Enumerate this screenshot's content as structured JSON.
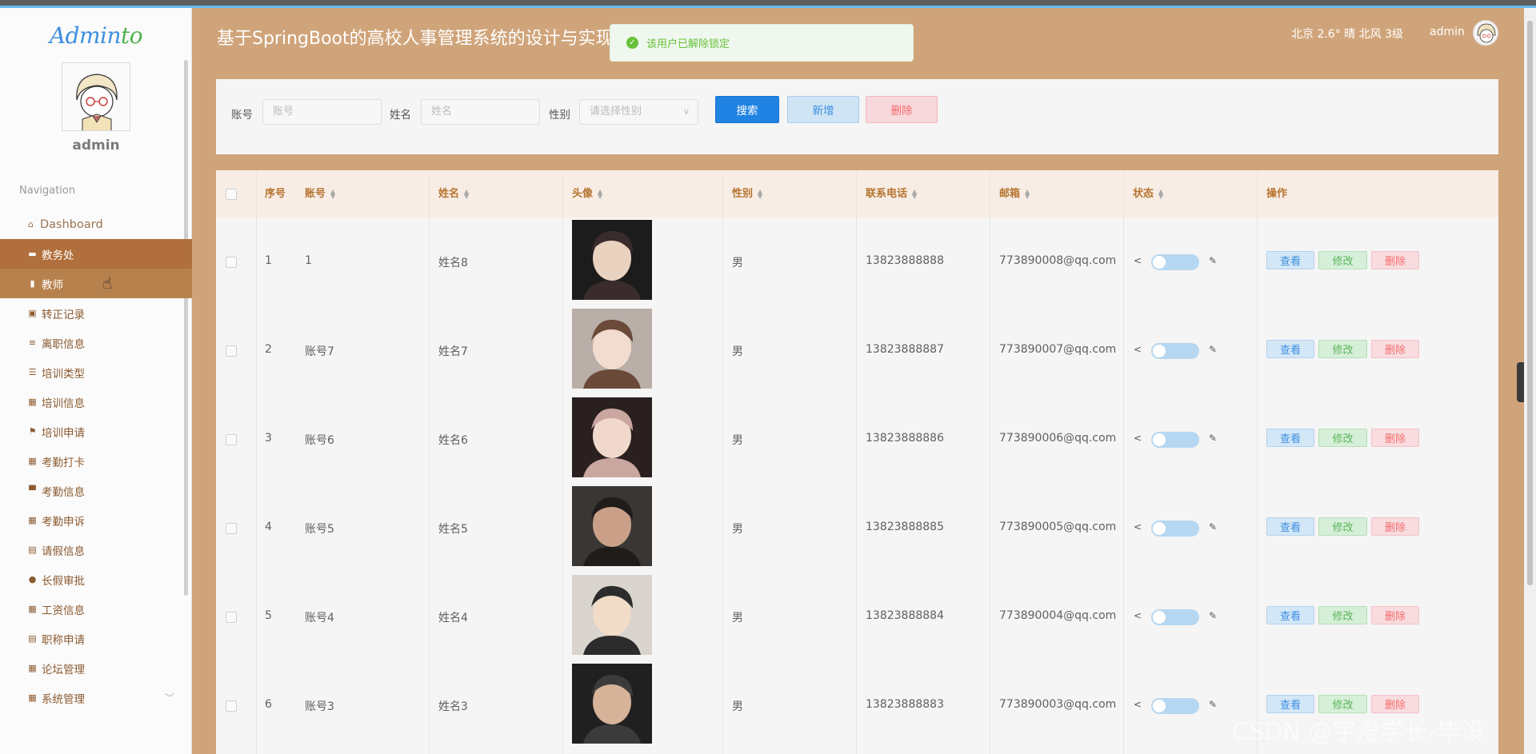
{
  "app": {
    "logo_a": "Admin",
    "logo_b": "to",
    "user": "admin",
    "nav_title": "Navigation",
    "page_title": "基于SpringBoot的高校人事管理系统的设计与实现"
  },
  "toast": {
    "message": "该用户已解除锁定"
  },
  "header": {
    "weather": "北京  2.6°  晴  北风  3级",
    "admin": "admin"
  },
  "nav": [
    {
      "label": "Dashboard",
      "icon": "home-icon"
    },
    {
      "label": "教务处",
      "icon": "card-icon"
    },
    {
      "label": "教师",
      "icon": "bar-chart-icon"
    },
    {
      "label": "转正记录",
      "icon": "chart-icon"
    },
    {
      "label": "离职信息",
      "icon": "lines-icon"
    },
    {
      "label": "培训类型",
      "icon": "list-icon"
    },
    {
      "label": "培训信息",
      "icon": "grid-icon"
    },
    {
      "label": "培训申请",
      "icon": "flag-icon"
    },
    {
      "label": "考勤打卡",
      "icon": "grid-icon"
    },
    {
      "label": "考勤信息",
      "icon": "monitor-icon"
    },
    {
      "label": "考勤申诉",
      "icon": "grid-icon"
    },
    {
      "label": "请假信息",
      "icon": "clipboard-icon"
    },
    {
      "label": "长假审批",
      "icon": "user-icon"
    },
    {
      "label": "工资信息",
      "icon": "table-icon"
    },
    {
      "label": "职称申请",
      "icon": "briefcase-icon"
    },
    {
      "label": "论坛管理",
      "icon": "grid-icon"
    },
    {
      "label": "系统管理",
      "icon": "grid-icon"
    }
  ],
  "search": {
    "account_label": "账号",
    "account_placeholder": "账号",
    "name_label": "姓名",
    "name_placeholder": "姓名",
    "gender_label": "性别",
    "gender_placeholder": "请选择性别",
    "search_btn": "搜索",
    "add_btn": "新增",
    "delete_btn": "删除"
  },
  "table": {
    "headers": {
      "no": "序号",
      "account": "账号",
      "name": "姓名",
      "avatar": "头像",
      "gender": "性别",
      "phone": "联系电话",
      "email": "邮箱",
      "status": "状态",
      "ops": "操作"
    },
    "actions": {
      "view": "查看",
      "edit": "修改",
      "delete": "删除"
    },
    "rows": [
      {
        "no": "1",
        "account": "1",
        "name": "姓名8",
        "gender": "男",
        "phone": "13823888888",
        "email": "773890008@qq.com"
      },
      {
        "no": "2",
        "account": "账号7",
        "name": "姓名7",
        "gender": "男",
        "phone": "13823888887",
        "email": "773890007@qq.com"
      },
      {
        "no": "3",
        "account": "账号6",
        "name": "姓名6",
        "gender": "男",
        "phone": "13823888886",
        "email": "773890006@qq.com"
      },
      {
        "no": "4",
        "account": "账号5",
        "name": "姓名5",
        "gender": "男",
        "phone": "13823888885",
        "email": "773890005@qq.com"
      },
      {
        "no": "5",
        "account": "账号4",
        "name": "姓名4",
        "gender": "男",
        "phone": "13823888884",
        "email": "773890004@qq.com"
      },
      {
        "no": "6",
        "account": "账号3",
        "name": "姓名3",
        "gender": "男",
        "phone": "13823888883",
        "email": "773890003@qq.com"
      }
    ]
  },
  "watermark": "CSDN @宇澄学长-毕设",
  "colors": {
    "header_bg": "#d0a47a",
    "active_nav": "#b06f3c",
    "primary": "#2083e3",
    "success": "#67c23a",
    "danger": "#f56c6c"
  }
}
